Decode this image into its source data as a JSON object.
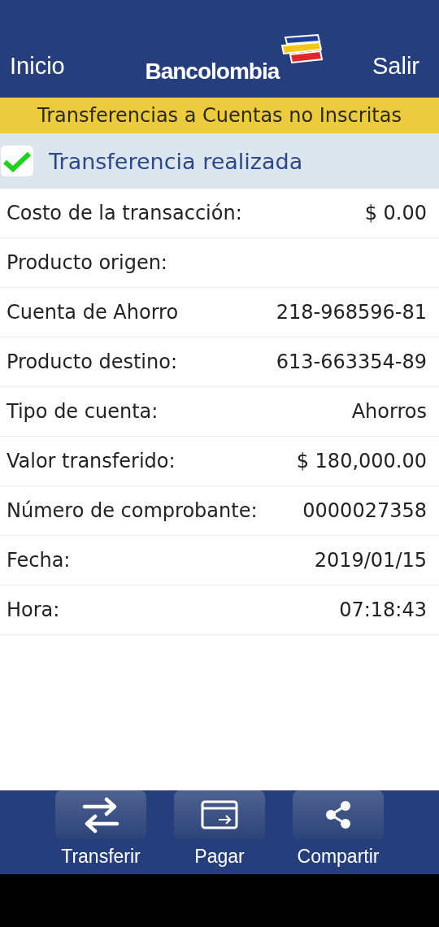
{
  "header": {
    "left_link": "Inicio",
    "logo": "Bancolombia",
    "right_link": "Salir"
  },
  "banner": "Transferencias a Cuentas no Inscritas",
  "status": {
    "text": "Transferencia realizada",
    "success": true
  },
  "details": [
    {
      "label": "Costo de la transacción:",
      "value": "$ 0.00"
    },
    {
      "label": "Producto origen:"
    },
    {
      "label": "Cuenta de Ahorro",
      "value": "218-968596-81"
    },
    {
      "label": "Producto destino:",
      "value": "613-663354-89"
    },
    {
      "label": "Tipo de cuenta:",
      "value": "Ahorros"
    },
    {
      "label": "Valor transferido:",
      "value": "$ 180,000.00"
    },
    {
      "label": "Número de comprobante:",
      "value": "0000027358"
    },
    {
      "label": "Fecha:",
      "value": "2019/01/15"
    },
    {
      "label": "Hora:",
      "value": "07:18:43"
    }
  ],
  "actions": [
    {
      "label": "Transferir",
      "kind": "transfer"
    },
    {
      "label": "Pagar",
      "kind": "pay"
    },
    {
      "label": "Compartir",
      "kind": "share"
    }
  ]
}
